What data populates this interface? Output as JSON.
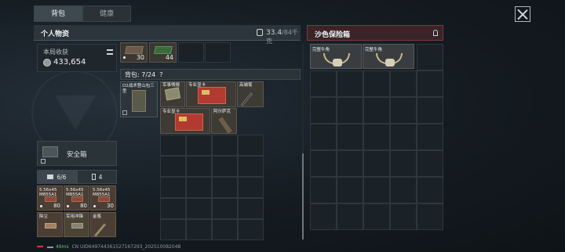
{
  "tabs": [
    {
      "label": "背包",
      "active": true
    },
    {
      "label": "健康",
      "active": false
    }
  ],
  "left_panel": {
    "title": "个人物资",
    "weight_current": "33.4",
    "weight_max": "/84千克"
  },
  "income": {
    "label": "本局收获",
    "value": "433,654"
  },
  "safe_box": {
    "label": "安全箱"
  },
  "pouches": [
    {
      "label": "6/6",
      "icon": "briefcase-icon",
      "active": true
    },
    {
      "label": "4",
      "icon": "battery-icon",
      "active": false
    }
  ],
  "pouch_items": [
    {
      "name": "5.56x45\nM855A1",
      "qty": "80"
    },
    {
      "name": "5.56x45\nM855A1",
      "qty": "80"
    },
    {
      "name": "5.56x45\nM855A1",
      "qty": "30"
    },
    {
      "name": "除尘",
      "qty": ""
    },
    {
      "name": "军用冲锋",
      "qty": ""
    },
    {
      "name": "金笔",
      "qty": ""
    }
  ],
  "top_items": [
    {
      "qty": "30"
    },
    {
      "qty": "44"
    }
  ],
  "backpack": {
    "label": "背包: 7/24",
    "help": "?"
  },
  "vest": {
    "name": "D2战术登山包三型"
  },
  "backpack_items": [
    {
      "name": "军事情报"
    },
    {
      "name": "专业显卡"
    },
    {
      "name": "高端笔"
    },
    {
      "name": "专业显卡"
    },
    {
      "name": "阿尔萨克"
    }
  ],
  "loot_panel": {
    "title": "沙色保险箱"
  },
  "loot_items": [
    {
      "name": "完整牛角"
    },
    {
      "name": "完整牛角"
    }
  ],
  "status": {
    "ping": "46ms",
    "uid": "CN UID649744361527167293_202510082048"
  },
  "colors": {
    "loot_accent": "#7a3a3e",
    "item_brown": "#4a3e35",
    "card_red": "#b33a30"
  }
}
